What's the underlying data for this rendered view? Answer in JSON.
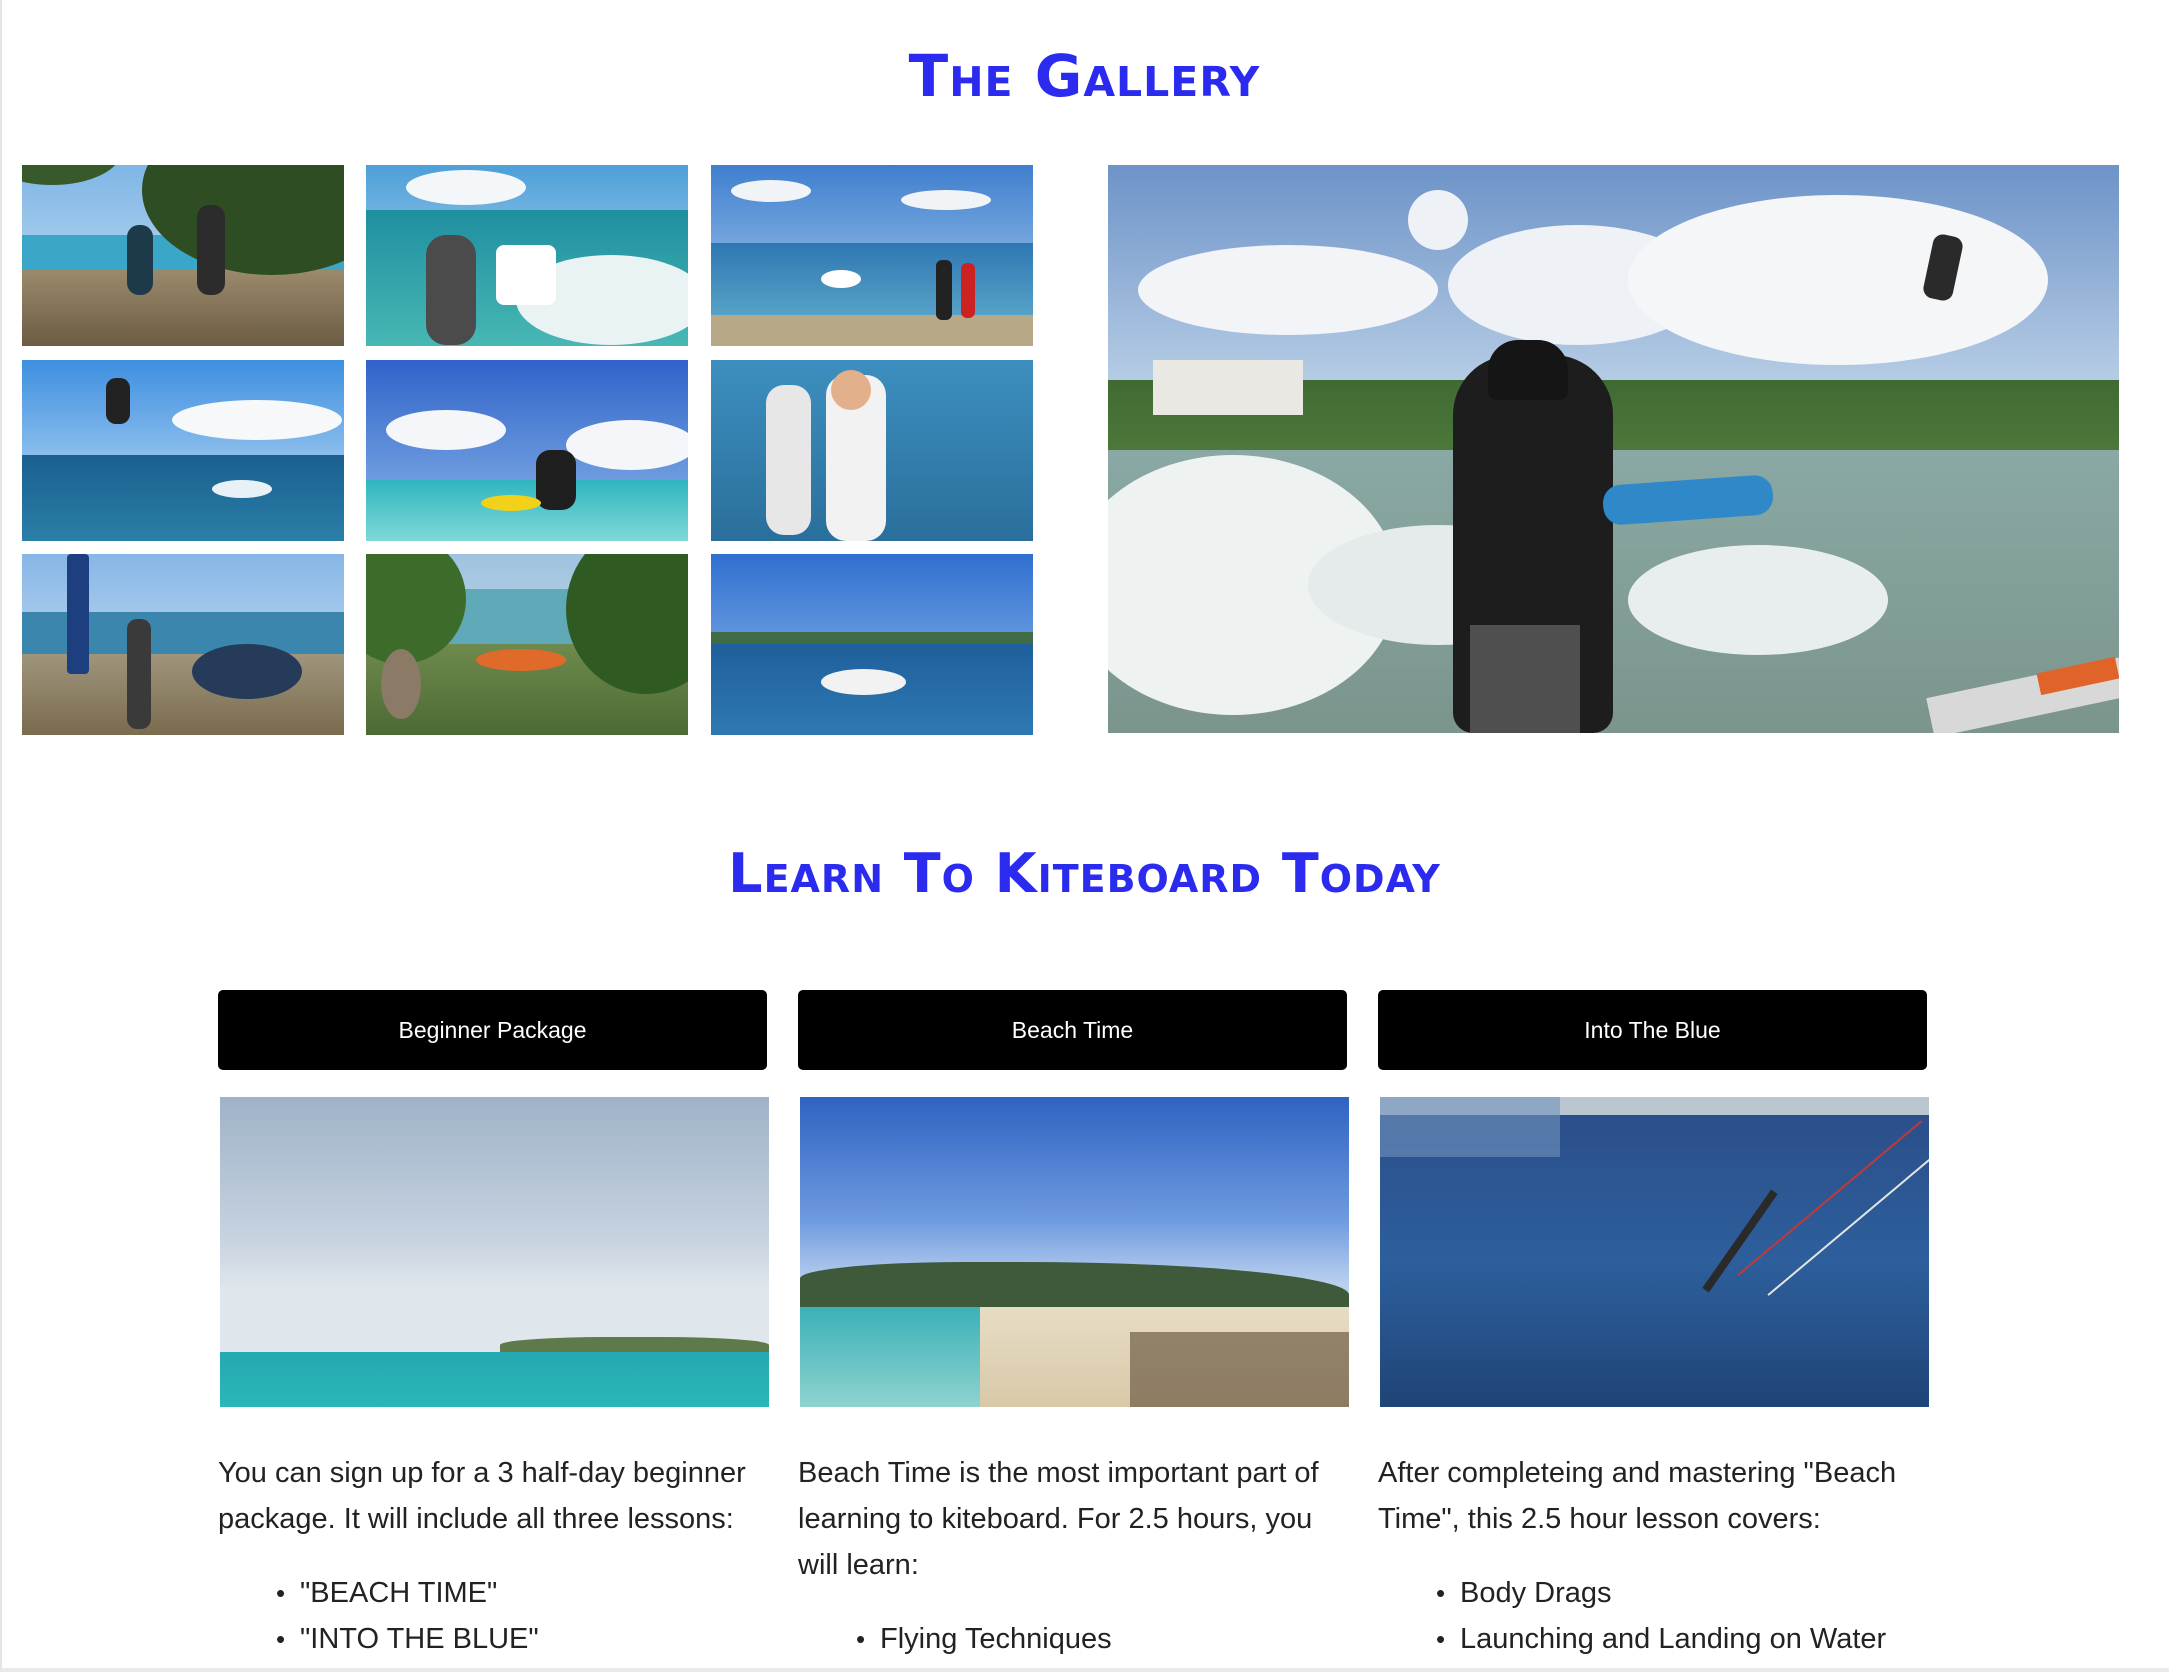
{
  "gallery": {
    "title": "The Gallery"
  },
  "learn": {
    "title": "Learn To Kiteboard Today",
    "cards": [
      {
        "button": "Beginner Package",
        "text": "You can sign up for a 3 half-day beginner package. It will include all three lessons:",
        "list": [
          "\"BEACH TIME\"",
          "\"INTO THE BLUE\""
        ]
      },
      {
        "button": "Beach Time",
        "text": "Beach Time is the most important part of learning to kiteboard. For 2.5 hours, you will learn:",
        "list": [
          "Flying Techniques"
        ]
      },
      {
        "button": "Into The Blue",
        "text": "After completeing and mastering \"Beach Time\", this 2.5 hour lesson covers:",
        "list": [
          "Body Drags",
          "Launching and Landing on Water"
        ]
      }
    ]
  },
  "colors": {
    "heading": "#2b2bf0",
    "button_bg": "#000000",
    "button_text": "#ffffff"
  }
}
